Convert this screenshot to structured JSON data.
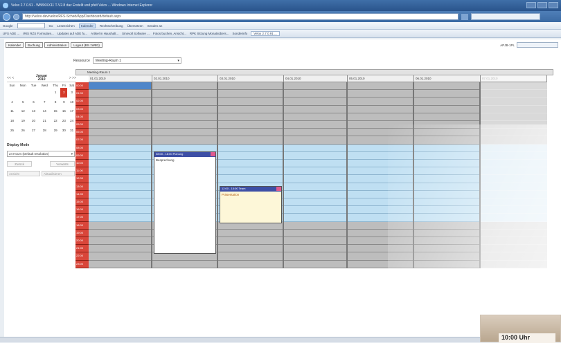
{
  "browser": {
    "window_title": "Velox 2.7.0.91 - WB8XXX11 T-V2.8 daz Erstellt und pfelt Velox ...  Windows Internet Explorer",
    "address": "http://velox-dev/velox/RFS-Sched/App/Dashboard/default.aspx",
    "toolbar_items": [
      "Google",
      "Go",
      "Lesezeichen",
      "Rechtschreibung",
      "Übersetzen",
      "Senden an"
    ],
    "highlighted_toolbar_item": "Kalender",
    "favorites": [
      "UFS ADE ...",
      "IRIS RZS Formulare...",
      "Updates auf ADE fu...",
      "Artikel in Haushalt...",
      "Sinnvoll Software ...",
      "Fotos buchen, Ansicht...",
      "RPK Sitzung Monatsübers...",
      "Sonderinfo",
      "Velox ..."
    ],
    "active_tab": "Velox 2.7.0.91 ..."
  },
  "app": {
    "tabs": [
      "Kalender",
      "Buchung",
      "Administration",
      "Logout (BS.1WB3)"
    ],
    "user_label": "APJB-1PL",
    "resource_label": "Ressource",
    "resource_value": "Meeting-Raum 1",
    "mini_calendar": {
      "prev": "<< <",
      "next": "> >>",
      "month_line1": "Januar",
      "month_line2": "2010",
      "weekdays": [
        "Sun",
        "Mon",
        "Tue",
        "Wed",
        "Thu",
        "Fri",
        "Sat"
      ],
      "weeks": [
        [
          "",
          "",
          "",
          "",
          "1",
          "2",
          "3"
        ],
        [
          "4",
          "5",
          "6",
          "7",
          "8",
          "9",
          "10"
        ],
        [
          "11",
          "12",
          "13",
          "14",
          "15",
          "16",
          "17"
        ],
        [
          "18",
          "19",
          "20",
          "21",
          "22",
          "23",
          "24"
        ],
        [
          "25",
          "26",
          "27",
          "28",
          "29",
          "30",
          "31"
        ]
      ],
      "today": "2"
    },
    "display_mode_label": "Display Mode",
    "display_mode_value": "24 Hours (Default resolution)",
    "buttons": [
      "Zurück",
      "Vorwärts"
    ],
    "second_row": [
      "Ansicht",
      "Aktualisieren"
    ]
  },
  "scheduler": {
    "resource_title": "Meeting-Raum 1",
    "days": [
      "01.01.2010",
      "02.01.2010",
      "03.01.2010",
      "04.01.2010",
      "05.01.2010",
      "06.01.2010",
      "07.01.2010"
    ],
    "hours": [
      "00:00",
      "01:00",
      "02:00",
      "03:00",
      "04:00",
      "05:00",
      "06:00",
      "07:00",
      "08:00",
      "09:00",
      "10:00",
      "11:00",
      "12:00",
      "13:00",
      "14:00",
      "15:00",
      "16:00",
      "17:00",
      "18:00",
      "19:00",
      "20:00",
      "21:00",
      "22:00",
      "23:00"
    ],
    "events": [
      {
        "day": 1,
        "header": "08:00 - 18:00  Planung",
        "body": "Besprechung"
      },
      {
        "day": 2,
        "header": "12:00 - 15:00  Team",
        "body": "Präsentation"
      }
    ]
  },
  "clock": {
    "time": "10:00 Uhr"
  }
}
